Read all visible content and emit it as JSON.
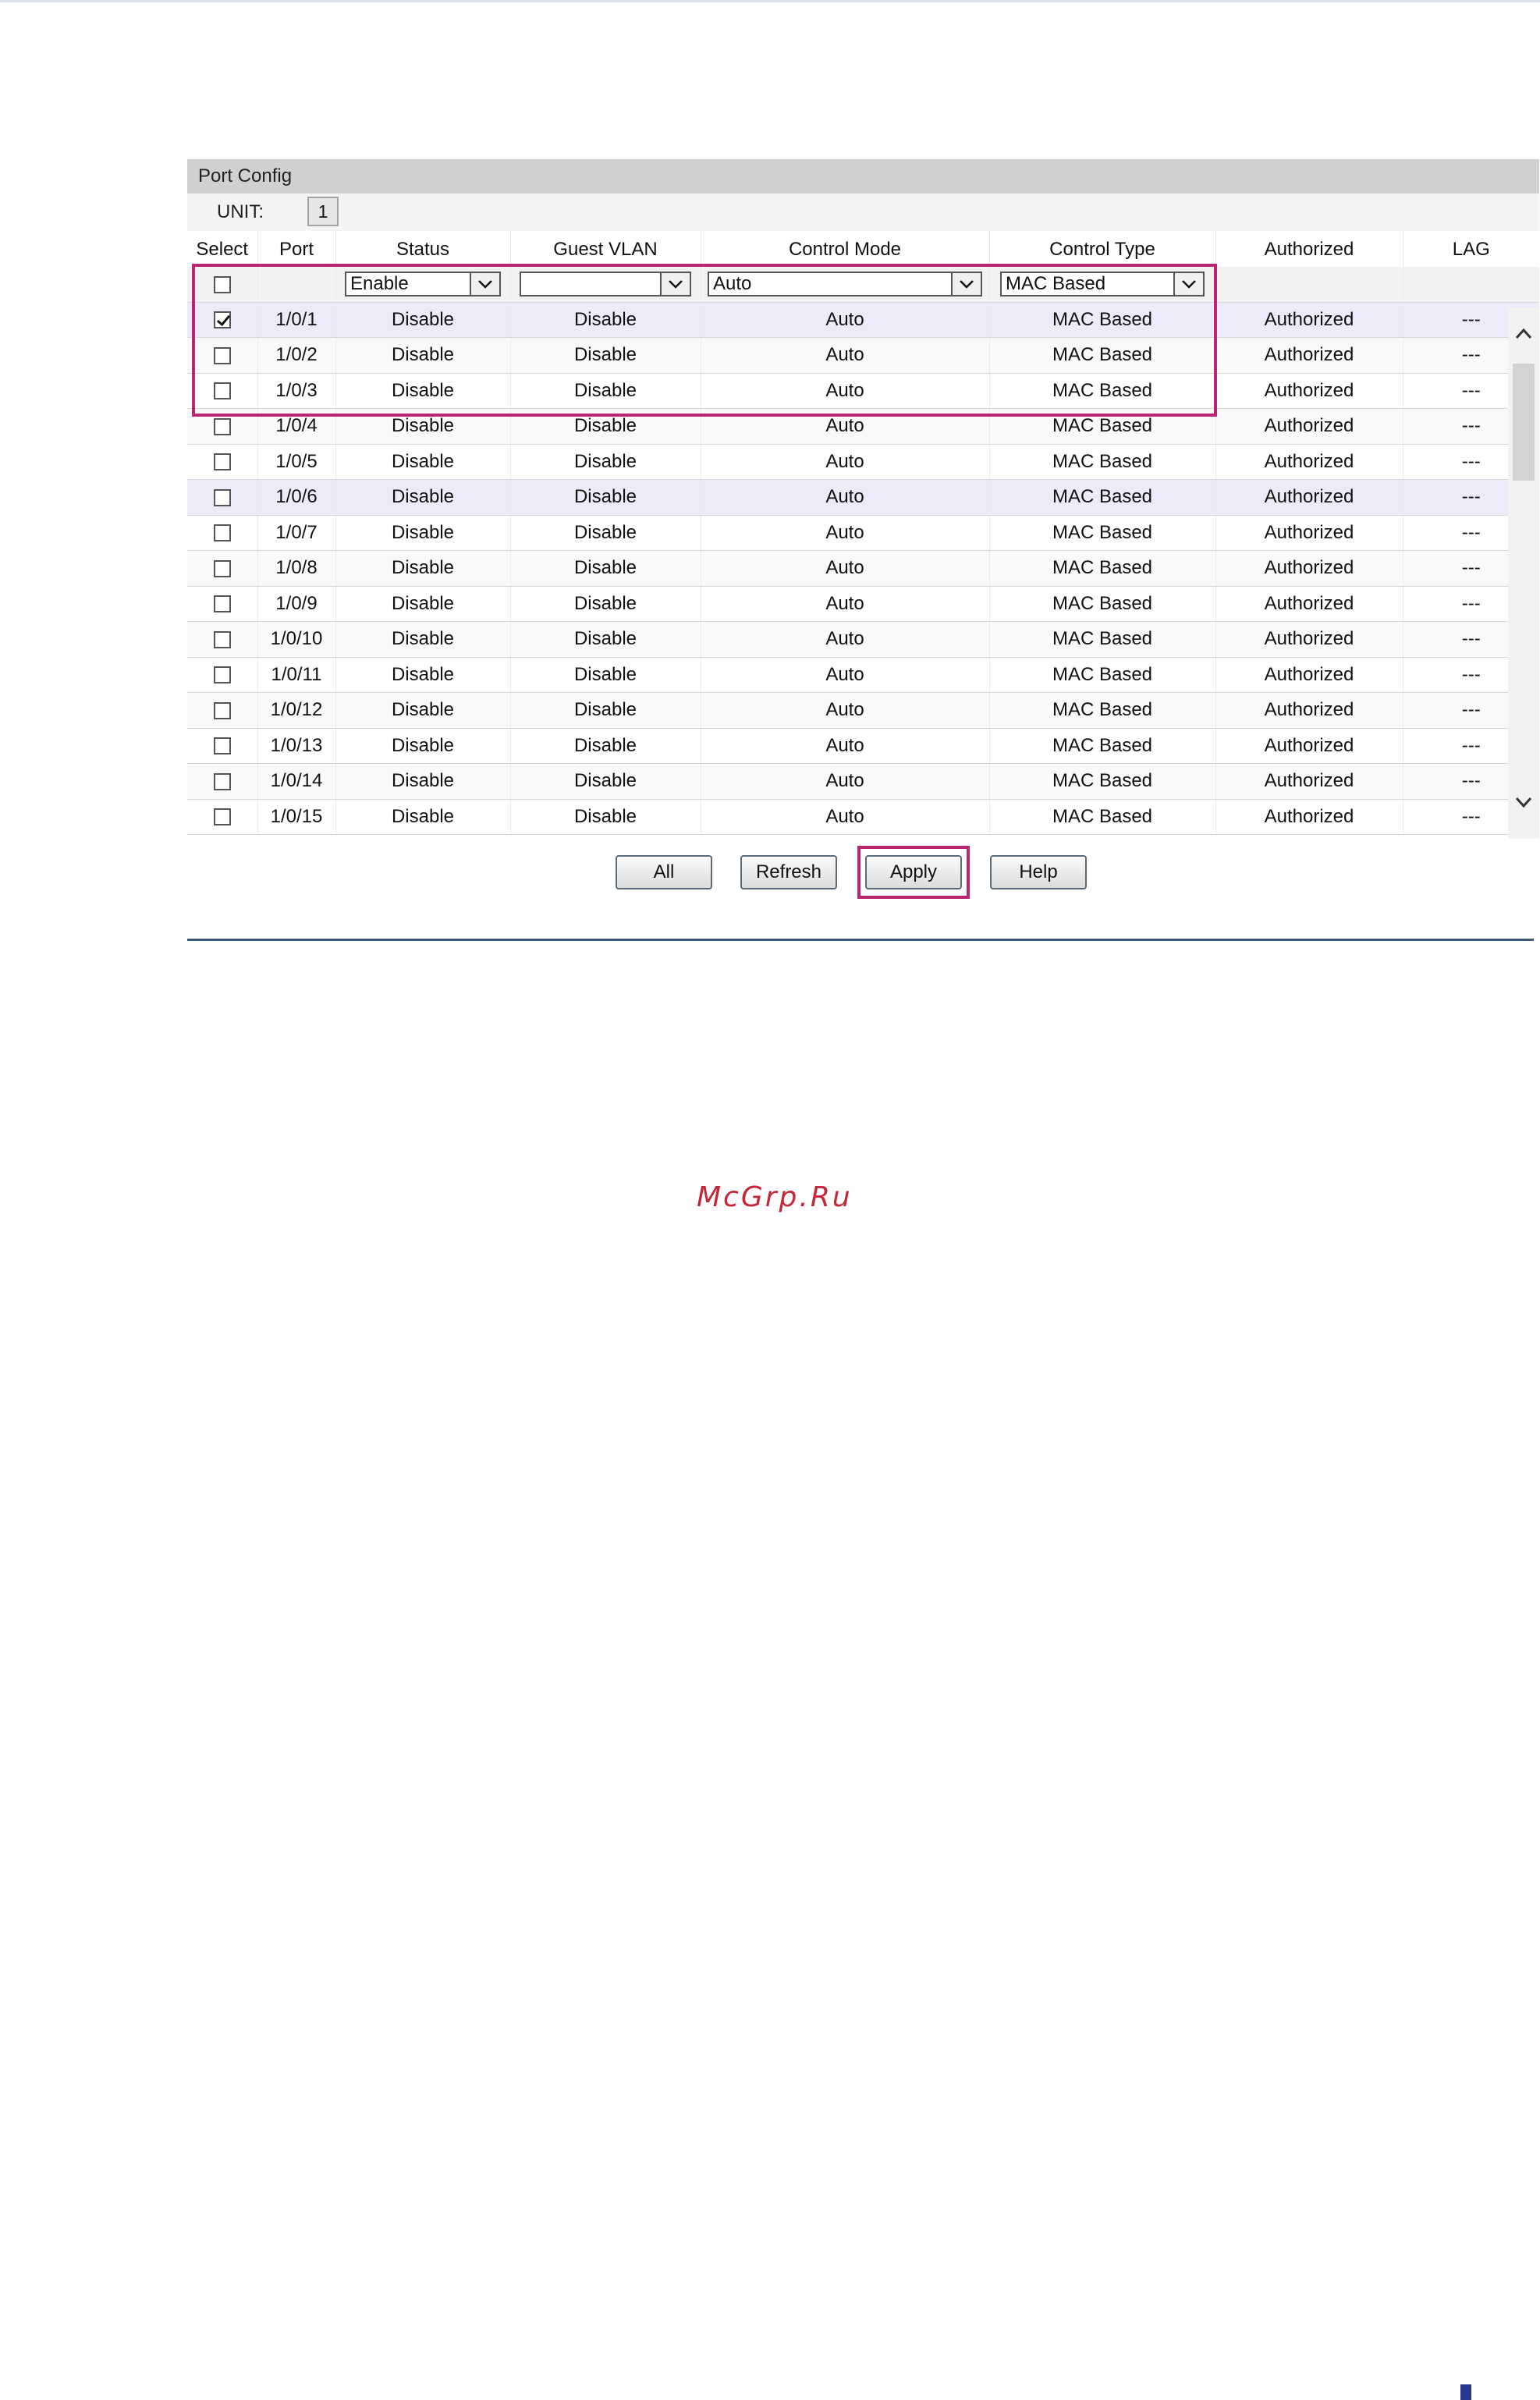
{
  "panel": {
    "title": "Port Config",
    "unit_label": "UNIT:",
    "unit_value": "1"
  },
  "columns": [
    "Select",
    "Port",
    "Status",
    "Guest VLAN",
    "Control Mode",
    "Control Type",
    "Authorized",
    "LAG"
  ],
  "filters": {
    "status": "Enable",
    "guest_vlan": "",
    "control_mode": "Auto",
    "control_type": "MAC Based"
  },
  "rows": [
    {
      "checked": true,
      "port": "1/0/1",
      "status": "Disable",
      "guest_vlan": "Disable",
      "control_mode": "Auto",
      "control_type": "MAC Based",
      "authorized": "Authorized",
      "lag": "---"
    },
    {
      "checked": false,
      "port": "1/0/2",
      "status": "Disable",
      "guest_vlan": "Disable",
      "control_mode": "Auto",
      "control_type": "MAC Based",
      "authorized": "Authorized",
      "lag": "---"
    },
    {
      "checked": false,
      "port": "1/0/3",
      "status": "Disable",
      "guest_vlan": "Disable",
      "control_mode": "Auto",
      "control_type": "MAC Based",
      "authorized": "Authorized",
      "lag": "---"
    },
    {
      "checked": false,
      "port": "1/0/4",
      "status": "Disable",
      "guest_vlan": "Disable",
      "control_mode": "Auto",
      "control_type": "MAC Based",
      "authorized": "Authorized",
      "lag": "---"
    },
    {
      "checked": false,
      "port": "1/0/5",
      "status": "Disable",
      "guest_vlan": "Disable",
      "control_mode": "Auto",
      "control_type": "MAC Based",
      "authorized": "Authorized",
      "lag": "---"
    },
    {
      "checked": false,
      "port": "1/0/6",
      "status": "Disable",
      "guest_vlan": "Disable",
      "control_mode": "Auto",
      "control_type": "MAC Based",
      "authorized": "Authorized",
      "lag": "---"
    },
    {
      "checked": false,
      "port": "1/0/7",
      "status": "Disable",
      "guest_vlan": "Disable",
      "control_mode": "Auto",
      "control_type": "MAC Based",
      "authorized": "Authorized",
      "lag": "---"
    },
    {
      "checked": false,
      "port": "1/0/8",
      "status": "Disable",
      "guest_vlan": "Disable",
      "control_mode": "Auto",
      "control_type": "MAC Based",
      "authorized": "Authorized",
      "lag": "---"
    },
    {
      "checked": false,
      "port": "1/0/9",
      "status": "Disable",
      "guest_vlan": "Disable",
      "control_mode": "Auto",
      "control_type": "MAC Based",
      "authorized": "Authorized",
      "lag": "---"
    },
    {
      "checked": false,
      "port": "1/0/10",
      "status": "Disable",
      "guest_vlan": "Disable",
      "control_mode": "Auto",
      "control_type": "MAC Based",
      "authorized": "Authorized",
      "lag": "---"
    },
    {
      "checked": false,
      "port": "1/0/11",
      "status": "Disable",
      "guest_vlan": "Disable",
      "control_mode": "Auto",
      "control_type": "MAC Based",
      "authorized": "Authorized",
      "lag": "---"
    },
    {
      "checked": false,
      "port": "1/0/12",
      "status": "Disable",
      "guest_vlan": "Disable",
      "control_mode": "Auto",
      "control_type": "MAC Based",
      "authorized": "Authorized",
      "lag": "---"
    },
    {
      "checked": false,
      "port": "1/0/13",
      "status": "Disable",
      "guest_vlan": "Disable",
      "control_mode": "Auto",
      "control_type": "MAC Based",
      "authorized": "Authorized",
      "lag": "---"
    },
    {
      "checked": false,
      "port": "1/0/14",
      "status": "Disable",
      "guest_vlan": "Disable",
      "control_mode": "Auto",
      "control_type": "MAC Based",
      "authorized": "Authorized",
      "lag": "---"
    },
    {
      "checked": false,
      "port": "1/0/15",
      "status": "Disable",
      "guest_vlan": "Disable",
      "control_mode": "Auto",
      "control_type": "MAC Based",
      "authorized": "Authorized",
      "lag": "---"
    }
  ],
  "buttons": {
    "all": "All",
    "refresh": "Refresh",
    "apply": "Apply",
    "help": "Help"
  },
  "watermark": "McGrp.Ru",
  "colors": {
    "highlight": "#b8266f",
    "header_bar": "#d0d0d0",
    "selected_row": "#ebebfa",
    "rule": "#3b5a7a"
  },
  "icons": [
    "checkbox",
    "check-icon",
    "chevron-down-icon",
    "chevron-up-icon"
  ]
}
